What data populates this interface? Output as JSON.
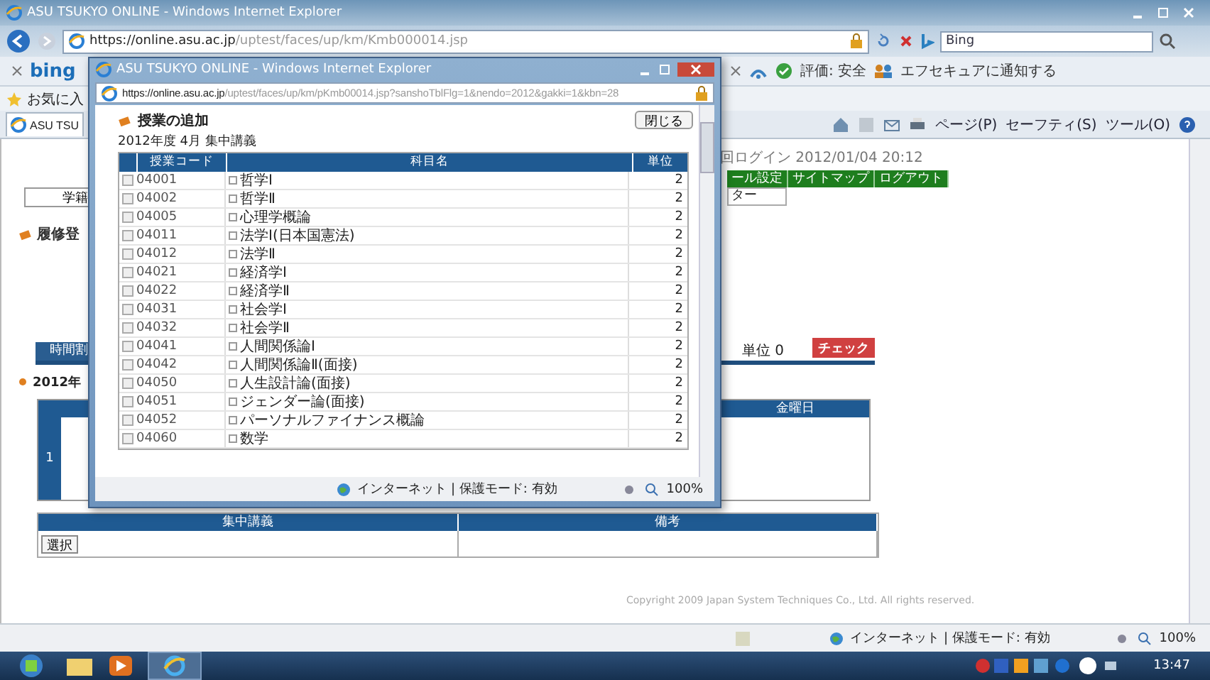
{
  "browser": {
    "title": "ASU TSUKYO ONLINE - Windows Internet Explorer",
    "address_host": "https://online.asu.ac.jp",
    "address_path": "/uptest/faces/up/km/Kmb000014.jsp",
    "search": {
      "placeholder": "Bing"
    }
  },
  "toolbar": {
    "logo": "bing",
    "rating": "評価: 安全",
    "notify": "エフセキュアに通知する"
  },
  "favorites": {
    "label": "お気に入"
  },
  "tab": {
    "label": "ASU TSU"
  },
  "command_bar": [
    "ページ(P)",
    "セーフティ(S)",
    "ツール(O)"
  ],
  "page": {
    "last_login": "回ログイン 2012/01/04 20:12",
    "nav_links": [
      "ール設定",
      "サイトマップ",
      "ログアウト"
    ],
    "submenu": "ター",
    "left_button": "学籍",
    "heading": "履修登",
    "tab": "時間割",
    "term": "2012年",
    "credits": "単位 0",
    "check_button": "チェック",
    "timetable": {
      "header": "金曜日",
      "period": "1"
    },
    "intensive": {
      "columns": [
        "集中講義",
        "備考"
      ],
      "select_button": "選択"
    },
    "copyright": "Copyright 2009 Japan System Techniques Co., Ltd. All rights reserved."
  },
  "status_bar": {
    "zone": "インターネット | 保護モード: 有効",
    "zoom": "100%"
  },
  "popup": {
    "title": "ASU TSUKYO ONLINE - Windows Internet Explorer",
    "address_host": "https://online.asu.ac.jp",
    "address_path": "/uptest/faces/up/km/pKmb00014.jsp?sanshoTblFlg=1&nendo=2012&gakki=1&kbn=28",
    "heading": "授業の追加",
    "close_button": "閉じる",
    "subtitle": "2012年度 4月 集中講義",
    "columns": [
      "授業コード",
      "科目名",
      "単位"
    ],
    "rows": [
      {
        "code": "04001",
        "name": "哲学Ⅰ",
        "credits": "2",
        "checked": false
      },
      {
        "code": "04002",
        "name": "哲学Ⅱ",
        "credits": "2",
        "checked": false
      },
      {
        "code": "04005",
        "name": "心理学概論",
        "credits": "2",
        "checked": false
      },
      {
        "code": "04011",
        "name": "法学Ⅰ(日本国憲法)",
        "credits": "2",
        "checked": false
      },
      {
        "code": "04012",
        "name": "法学Ⅱ",
        "credits": "2",
        "checked": false
      },
      {
        "code": "04021",
        "name": "経済学Ⅰ",
        "credits": "2",
        "checked": false
      },
      {
        "code": "04022",
        "name": "経済学Ⅱ",
        "credits": "2",
        "checked": false
      },
      {
        "code": "04031",
        "name": "社会学Ⅰ",
        "credits": "2",
        "checked": false
      },
      {
        "code": "04032",
        "name": "社会学Ⅱ",
        "credits": "2",
        "checked": false
      },
      {
        "code": "04041",
        "name": "人間関係論Ⅰ",
        "credits": "2",
        "checked": false
      },
      {
        "code": "04042",
        "name": "人間関係論Ⅱ(面接)",
        "credits": "2",
        "checked": false
      },
      {
        "code": "04050",
        "name": "人生設計論(面接)",
        "credits": "2",
        "checked": false
      },
      {
        "code": "04051",
        "name": "ジェンダー論(面接)",
        "credits": "2",
        "checked": false
      },
      {
        "code": "04052",
        "name": "パーソナルファイナンス概論",
        "credits": "2",
        "checked": false
      },
      {
        "code": "04060",
        "name": "数学",
        "credits": "2",
        "checked": false
      }
    ],
    "status_zone": "インターネット | 保護モード: 有効",
    "status_zoom": "100%"
  },
  "taskbar": {
    "clock": "13:47"
  }
}
